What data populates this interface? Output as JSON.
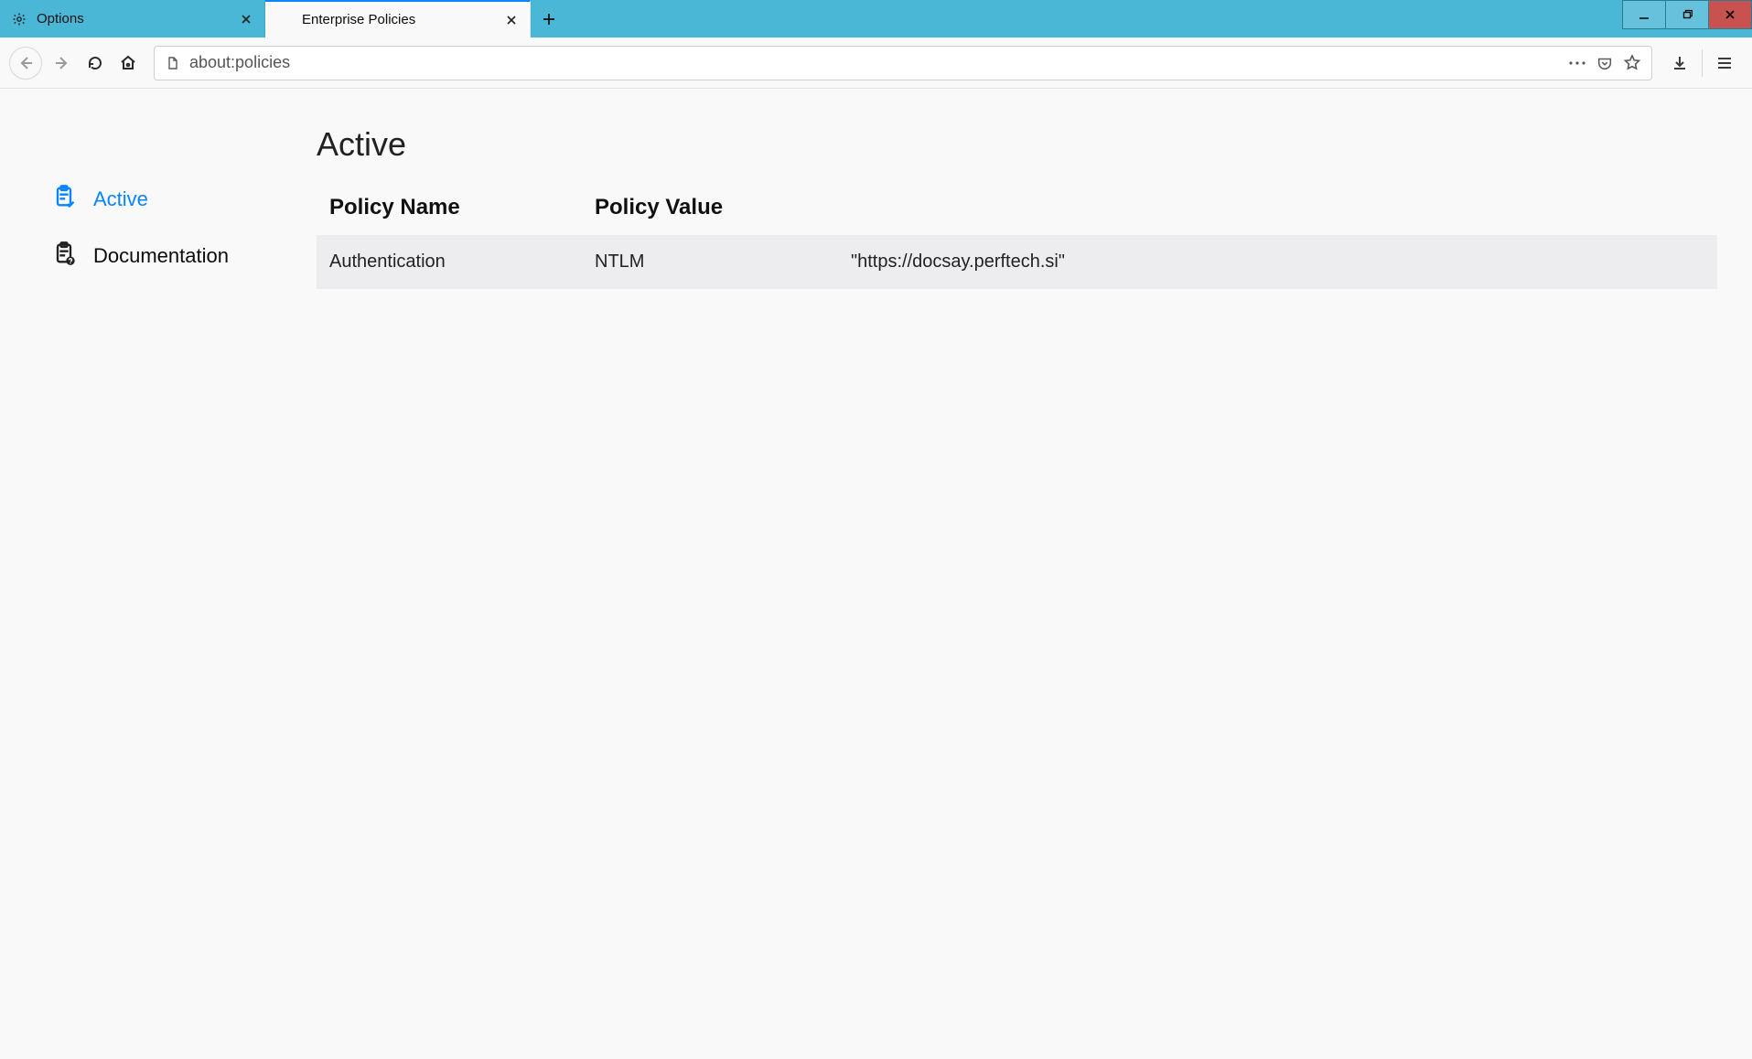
{
  "tabs": {
    "inactive": {
      "title": "Options"
    },
    "active": {
      "title": "Enterprise Policies"
    }
  },
  "urlbar": {
    "value": "about:policies"
  },
  "sidebar": {
    "active_label": "Active",
    "documentation_label": "Documentation"
  },
  "content": {
    "heading": "Active",
    "th_name": "Policy Name",
    "th_value": "Policy Value",
    "row": {
      "name": "Authentication",
      "value_key": "NTLM",
      "value_detail": "\"https://docsay.perftech.si\""
    }
  }
}
